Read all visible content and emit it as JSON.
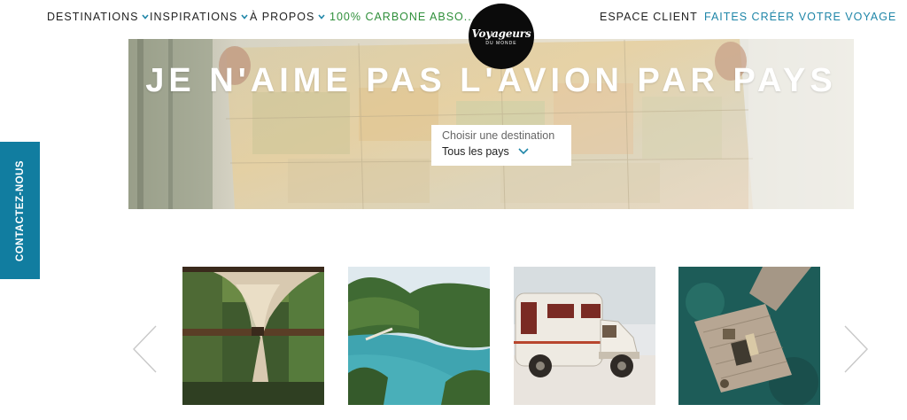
{
  "nav": {
    "destinations": "DESTINATIONS",
    "inspirations": "INSPIRATIONS",
    "a_propos": "À PROPOS",
    "carbone": "100% CARBONE ABSO...",
    "espace_client": "ESPACE CLIENT",
    "faites_creer": "FAITES CRÉER VOTRE VOYAGE"
  },
  "logo": {
    "name": "Voyageurs",
    "subtitle": "DU MONDE"
  },
  "hero": {
    "title": "JE N'AIME PAS L'AVION PAR PAYS",
    "destination_label": "Choisir une destination",
    "destination_value": "Tous les pays"
  },
  "contact_tab": {
    "label": "CONTACTEZ-NOUS"
  },
  "carousel": {
    "cards": [
      {
        "icon": "curtain-window-photo"
      },
      {
        "icon": "lagoon-islands-photo"
      },
      {
        "icon": "camper-van-photo"
      },
      {
        "icon": "wooden-pier-photo"
      }
    ]
  },
  "colors": {
    "accent_blue": "#1f86a8",
    "contact_tab": "#117da0",
    "green": "#2f8f3a"
  }
}
